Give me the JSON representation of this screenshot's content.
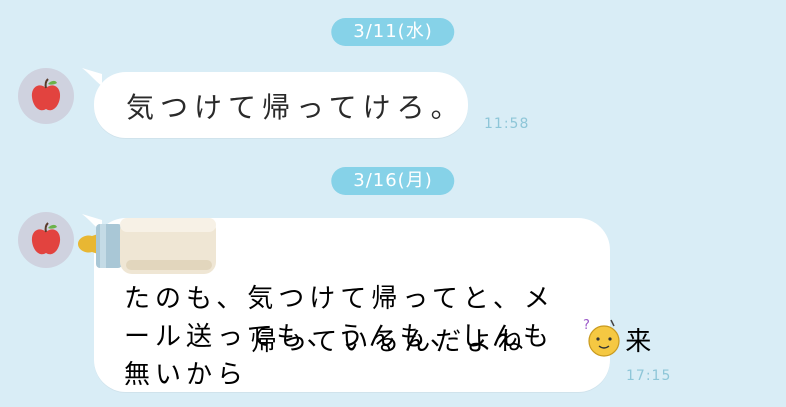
{
  "chat": {
    "date1": "3/11(水)",
    "date2": "3/16(月)",
    "messages": [
      {
        "text": "気つけて帰ってけろ。",
        "time": "11:58"
      },
      {
        "text_line1": "帰っているんだよね",
        "text_line1_end": "来",
        "text_rest": "たのも、気つけて帰ってと、メ\nール送っても、うんも、しんも\n無いから",
        "time": "17:15",
        "sticker_icon": "baby-bottle-icon",
        "emoji_icon": "confused-face-emoji-icon"
      }
    ],
    "avatar_icon": "apple-icon"
  },
  "colors": {
    "background": "#d9edf6",
    "date_pill": "#86d2e8",
    "bubble": "#ffffff",
    "time_text": "#8ec6d8",
    "avatar_bg": "#cfd2df",
    "apple_red": "#e2433f"
  }
}
